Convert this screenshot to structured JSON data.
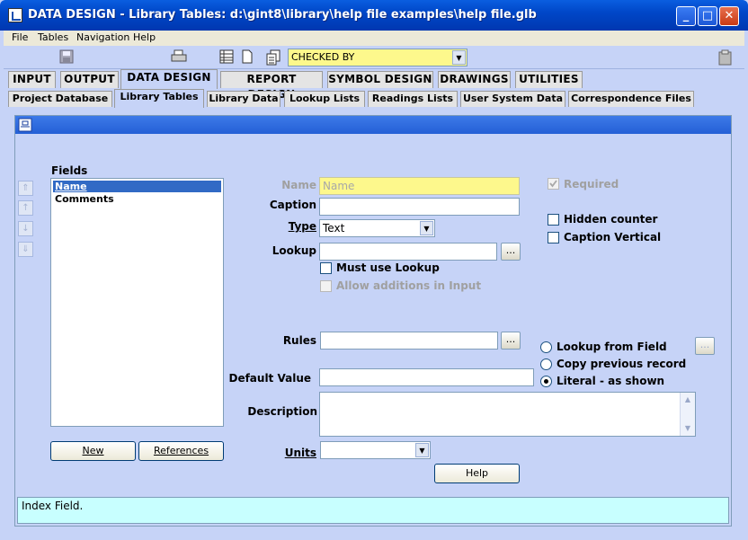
{
  "window": {
    "title": "DATA DESIGN - Library Tables:  d:\\gint8\\library\\help file examples\\help file.glb"
  },
  "menu": [
    "File",
    "Tables",
    "Navigation",
    "Help"
  ],
  "toolbar": {
    "combo_value": "CHECKED BY"
  },
  "main_tabs": [
    "INPUT",
    "OUTPUT",
    "DATA DESIGN",
    "REPORT DESIGN",
    "SYMBOL DESIGN",
    "DRAWINGS",
    "UTILITIES"
  ],
  "sub_tabs": [
    "Project Database",
    "Library Tables",
    "Library Data",
    "Lookup Lists",
    "Readings Lists",
    "User System Data",
    "Correspondence Files"
  ],
  "fields": {
    "label": "Fields",
    "items": [
      "Name",
      "Comments"
    ]
  },
  "buttons": {
    "new": "New",
    "references": "References",
    "help": "Help"
  },
  "form": {
    "name_label": "Name",
    "name_value": "Name",
    "caption_label": "Caption",
    "caption_value": "",
    "type_label": "Type",
    "type_value": "Text",
    "lookup_label": "Lookup",
    "lookup_value": "",
    "must_use_lookup": "Must use Lookup",
    "allow_additions": "Allow additions in Input",
    "rules_label": "Rules",
    "rules_value": "",
    "default_label": "Default Value",
    "default_value": "",
    "description_label": "Description",
    "description_value": "",
    "units_label": "Units",
    "units_value": "",
    "required": "Required",
    "hidden_counter": "Hidden counter",
    "caption_vertical": "Caption Vertical",
    "lookup_from_field": "Lookup from Field",
    "copy_previous": "Copy previous record",
    "literal": "Literal - as shown",
    "ellipsis": "..."
  },
  "status": {
    "text": "Index Field."
  }
}
